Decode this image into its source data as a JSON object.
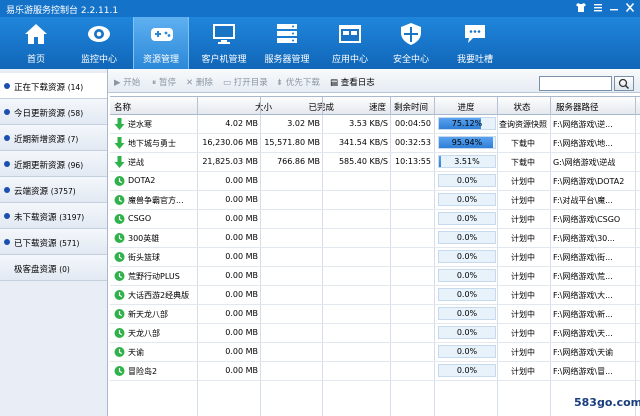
{
  "window": {
    "title": "易乐游服务控制台 2.2.11.1"
  },
  "nav": [
    {
      "label": "首页",
      "icon": "home-icon"
    },
    {
      "label": "监控中心",
      "icon": "eye-icon"
    },
    {
      "label": "资源管理",
      "icon": "gamepad-icon",
      "active": true
    },
    {
      "label": "客户机管理",
      "icon": "monitor-icon"
    },
    {
      "label": "服务器管理",
      "icon": "server-icon"
    },
    {
      "label": "应用中心",
      "icon": "app-window-icon"
    },
    {
      "label": "安全中心",
      "icon": "shield-icon"
    },
    {
      "label": "我要吐槽",
      "icon": "chat-bubble-icon"
    }
  ],
  "sidebar": [
    {
      "label": "正在下载资源",
      "count": "(14)",
      "active": true
    },
    {
      "label": "今日更新资源",
      "count": "(58)"
    },
    {
      "label": "近期新增资源",
      "count": "(7)"
    },
    {
      "label": "近期更新资源",
      "count": "(96)"
    },
    {
      "label": "云端资源",
      "count": "(3757)"
    },
    {
      "label": "未下载资源",
      "count": "(3197)"
    },
    {
      "label": "已下载资源",
      "count": "(571)"
    },
    {
      "label": "极客盘资源",
      "count": "(0)"
    }
  ],
  "toolbar": {
    "start": "开始",
    "pause": "暂停",
    "delete": "删除",
    "open_dir": "打开目录",
    "priority": "优先下载",
    "view_log": "查看日志",
    "search_placeholder": ""
  },
  "table": {
    "headers": [
      "名称",
      "大小",
      "已完成",
      "速度",
      "剩余时间",
      "进度",
      "状态",
      "服务器路径"
    ],
    "rows": [
      {
        "name": "逆水寒",
        "size": "4.02 MB",
        "done": "3.02 MB",
        "speed": "3.53 KB/S",
        "remain": "00:04:50",
        "progress": "75.12%",
        "progress_value": 75.12,
        "status": "查询资源快照",
        "path": "F:\\网络游戏\\逆...",
        "icon": "download-arrow-icon"
      },
      {
        "name": "地下城与勇士",
        "size": "16,230.06 MB",
        "done": "15,571.80 MB",
        "speed": "341.54 KB/S",
        "remain": "00:32:53",
        "progress": "95.94%",
        "progress_value": 95.94,
        "status": "下载中",
        "path": "F:\\网络游戏\\地...",
        "icon": "download-arrow-icon"
      },
      {
        "name": "逆战",
        "size": "21,825.03 MB",
        "done": "766.86 MB",
        "speed": "585.40 KB/S",
        "remain": "10:13:55",
        "progress": "3.51%",
        "progress_value": 3.51,
        "status": "下载中",
        "path": "G:\\网络游戏\\逆战",
        "icon": "download-arrow-icon"
      },
      {
        "name": "DOTA2",
        "size": "0.00 MB",
        "done": "",
        "speed": "",
        "remain": "",
        "progress": "0.0%",
        "progress_value": 0,
        "status": "计划中",
        "path": "F:\\网络游戏\\DOTA2",
        "icon": "clock-icon"
      },
      {
        "name": "魔兽争霸官方...",
        "size": "0.00 MB",
        "done": "",
        "speed": "",
        "remain": "",
        "progress": "0.0%",
        "progress_value": 0,
        "status": "计划中",
        "path": "F:\\对战平台\\魔...",
        "icon": "clock-icon"
      },
      {
        "name": "CSGO",
        "size": "0.00 MB",
        "done": "",
        "speed": "",
        "remain": "",
        "progress": "0.0%",
        "progress_value": 0,
        "status": "计划中",
        "path": "F:\\网络游戏\\CSGO",
        "icon": "clock-icon"
      },
      {
        "name": "300英雄",
        "size": "0.00 MB",
        "done": "",
        "speed": "",
        "remain": "",
        "progress": "0.0%",
        "progress_value": 0,
        "status": "计划中",
        "path": "F:\\网络游戏\\30...",
        "icon": "clock-icon"
      },
      {
        "name": "街头篮球",
        "size": "0.00 MB",
        "done": "",
        "speed": "",
        "remain": "",
        "progress": "0.0%",
        "progress_value": 0,
        "status": "计划中",
        "path": "F:\\网络游戏\\街...",
        "icon": "clock-icon"
      },
      {
        "name": "荒野行动PLUS",
        "size": "0.00 MB",
        "done": "",
        "speed": "",
        "remain": "",
        "progress": "0.0%",
        "progress_value": 0,
        "status": "计划中",
        "path": "F:\\网络游戏\\荒...",
        "icon": "clock-icon"
      },
      {
        "name": "大话西游2经典版",
        "size": "0.00 MB",
        "done": "",
        "speed": "",
        "remain": "",
        "progress": "0.0%",
        "progress_value": 0,
        "status": "计划中",
        "path": "F:\\网络游戏\\大...",
        "icon": "clock-icon"
      },
      {
        "name": "新天龙八部",
        "size": "0.00 MB",
        "done": "",
        "speed": "",
        "remain": "",
        "progress": "0.0%",
        "progress_value": 0,
        "status": "计划中",
        "path": "F:\\网络游戏\\新...",
        "icon": "clock-icon"
      },
      {
        "name": "天龙八部",
        "size": "0.00 MB",
        "done": "",
        "speed": "",
        "remain": "",
        "progress": "0.0%",
        "progress_value": 0,
        "status": "计划中",
        "path": "F:\\网络游戏\\天...",
        "icon": "clock-icon"
      },
      {
        "name": "天谕",
        "size": "0.00 MB",
        "done": "",
        "speed": "",
        "remain": "",
        "progress": "0.0%",
        "progress_value": 0,
        "status": "计划中",
        "path": "F:\\网络游戏\\天谕",
        "icon": "clock-icon"
      },
      {
        "name": "冒险岛2",
        "size": "0.00 MB",
        "done": "",
        "speed": "",
        "remain": "",
        "progress": "0.0%",
        "progress_value": 0,
        "status": "计划中",
        "path": "F:\\网络游戏\\冒...",
        "icon": "clock-icon"
      }
    ]
  },
  "watermark": "583go.com",
  "colors": {
    "nav_blue": "#1473c9",
    "progress_blue": "#2f7fd8",
    "download_green": "#2db34a"
  }
}
